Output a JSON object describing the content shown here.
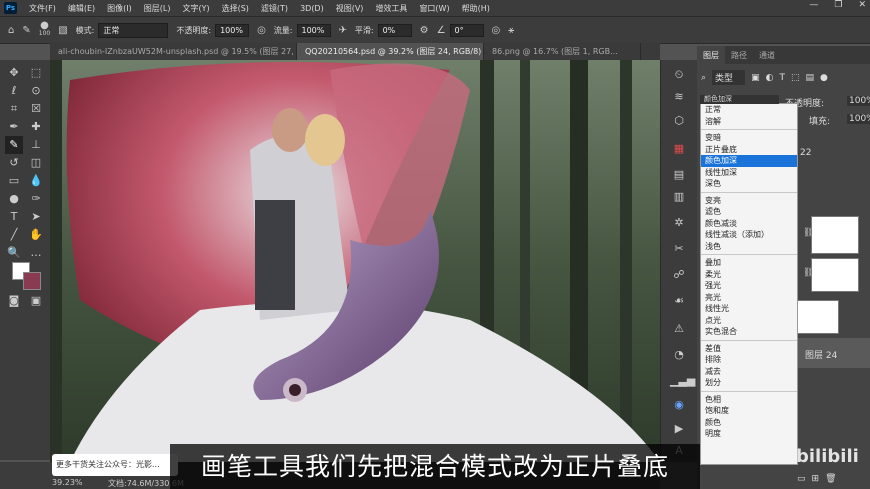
{
  "menubar": {
    "items": [
      "文件(F)",
      "编辑(E)",
      "图像(I)",
      "图层(L)",
      "文字(Y)",
      "选择(S)",
      "滤镜(T)",
      "3D(D)",
      "视图(V)",
      "增效工具",
      "窗口(W)",
      "帮助(H)"
    ]
  },
  "options": {
    "brush_size": "100",
    "mode_label": "模式:",
    "mode_value": "正常",
    "opacity_label": "不透明度:",
    "opacity_value": "100%",
    "flow_label": "流量:",
    "flow_value": "100%",
    "smooth_label": "平滑:",
    "smooth_value": "0%",
    "angle_value": "0°"
  },
  "tabs": [
    "ali-choubin-IZnbzaUW52M-unsplash.psd @ 19.5% (图层 27, RG...",
    "QQ20210564.psd @ 39.2% (图层 24, RGB/8) *",
    "86.png @ 16.7% (图层 1, RGB..."
  ],
  "status": {
    "zoom": "39.23%",
    "doc": "文档:74.6M/330.6M"
  },
  "panel": {
    "tabs": [
      "图层",
      "路径",
      "通道"
    ],
    "filter_label": "类型",
    "blend_selected": "颜色加深",
    "opacity_label": "不透明度:",
    "opacity_value": "100%",
    "fill_label": "填充:",
    "fill_value": "100%",
    "layer_partial": "22",
    "layer_name": "图层 24"
  },
  "blend_modes": [
    [
      "正常",
      "溶解"
    ],
    [
      "变暗",
      "正片叠底",
      "颜色加深",
      "线性加深",
      "深色"
    ],
    [
      "变亮",
      "滤色",
      "颜色减淡",
      "线性减淡（添加）",
      "浅色"
    ],
    [
      "叠加",
      "柔光",
      "强光",
      "亮光",
      "线性光",
      "点光",
      "实色混合"
    ],
    [
      "差值",
      "排除",
      "减去",
      "划分"
    ],
    [
      "色相",
      "饱和度",
      "颜色",
      "明度"
    ]
  ],
  "overlay": {
    "subtitle": "画笔工具我们先把混合模式改为正片叠底",
    "wechat": "更多干货关注公众号：光影...",
    "watermark": "bilibili"
  },
  "colors": {
    "foreground": "#ffffff",
    "background": "#8a3a52",
    "selection": "#1a73d9"
  }
}
